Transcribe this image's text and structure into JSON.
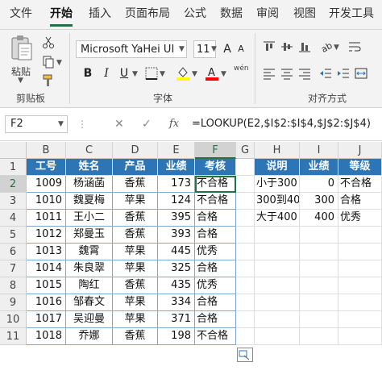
{
  "tabs": [
    "文件",
    "开始",
    "插入",
    "页面布局",
    "公式",
    "数据",
    "审阅",
    "视图",
    "开发工具"
  ],
  "active_tab": "开始",
  "ribbon": {
    "clipboard": {
      "paste_label": "粘贴",
      "group_label": "剪贴板"
    },
    "font": {
      "font_name": "Microsoft YaHei UI",
      "font_size": "11",
      "bold": "B",
      "italic": "I",
      "underline": "U",
      "grow": "A",
      "shrink": "A",
      "wen": "wén",
      "group_label": "字体",
      "fill_color": "#ffff00",
      "font_color": "#ff0000"
    },
    "alignment": {
      "group_label": "对齐方式"
    }
  },
  "formula_bar": {
    "name_box": "F2",
    "cancel": "✕",
    "enter": "✓",
    "fx": "fx",
    "formula": "=LOOKUP(E2,$I$2:$I$4,$J$2:$J$4)"
  },
  "columns": [
    "B",
    "C",
    "D",
    "E",
    "F",
    "G",
    "H",
    "I",
    "J"
  ],
  "rows": [
    "1",
    "2",
    "3",
    "4",
    "5",
    "6",
    "7",
    "8",
    "9",
    "10",
    "11"
  ],
  "table": {
    "headers": [
      "工号",
      "姓名",
      "产品",
      "业绩",
      "考核"
    ],
    "records": [
      [
        "1009",
        "杨涵菡",
        "香蕉",
        "173",
        "不合格"
      ],
      [
        "1010",
        "魏夏梅",
        "苹果",
        "124",
        "不合格"
      ],
      [
        "1011",
        "王小二",
        "香蕉",
        "395",
        "合格"
      ],
      [
        "1012",
        "郑曼玉",
        "香蕉",
        "393",
        "合格"
      ],
      [
        "1013",
        "魏霄",
        "苹果",
        "445",
        "优秀"
      ],
      [
        "1014",
        "朱良翠",
        "苹果",
        "325",
        "合格"
      ],
      [
        "1015",
        "陶红",
        "香蕉",
        "435",
        "优秀"
      ],
      [
        "1016",
        "邹春文",
        "苹果",
        "334",
        "合格"
      ],
      [
        "1017",
        "吴迎曼",
        "苹果",
        "371",
        "合格"
      ],
      [
        "1018",
        "乔娜",
        "香蕉",
        "198",
        "不合格"
      ]
    ]
  },
  "lookup": {
    "headers": [
      "说明",
      "业绩",
      "等级"
    ],
    "records": [
      [
        "小于300",
        "0",
        "不合格"
      ],
      [
        "300到400",
        "300",
        "合格"
      ],
      [
        "大于400",
        "400",
        "优秀"
      ]
    ]
  },
  "colors": {
    "accent": "#217346",
    "header_fill": "#2e75b6",
    "table_border": "#7fa7cf"
  }
}
